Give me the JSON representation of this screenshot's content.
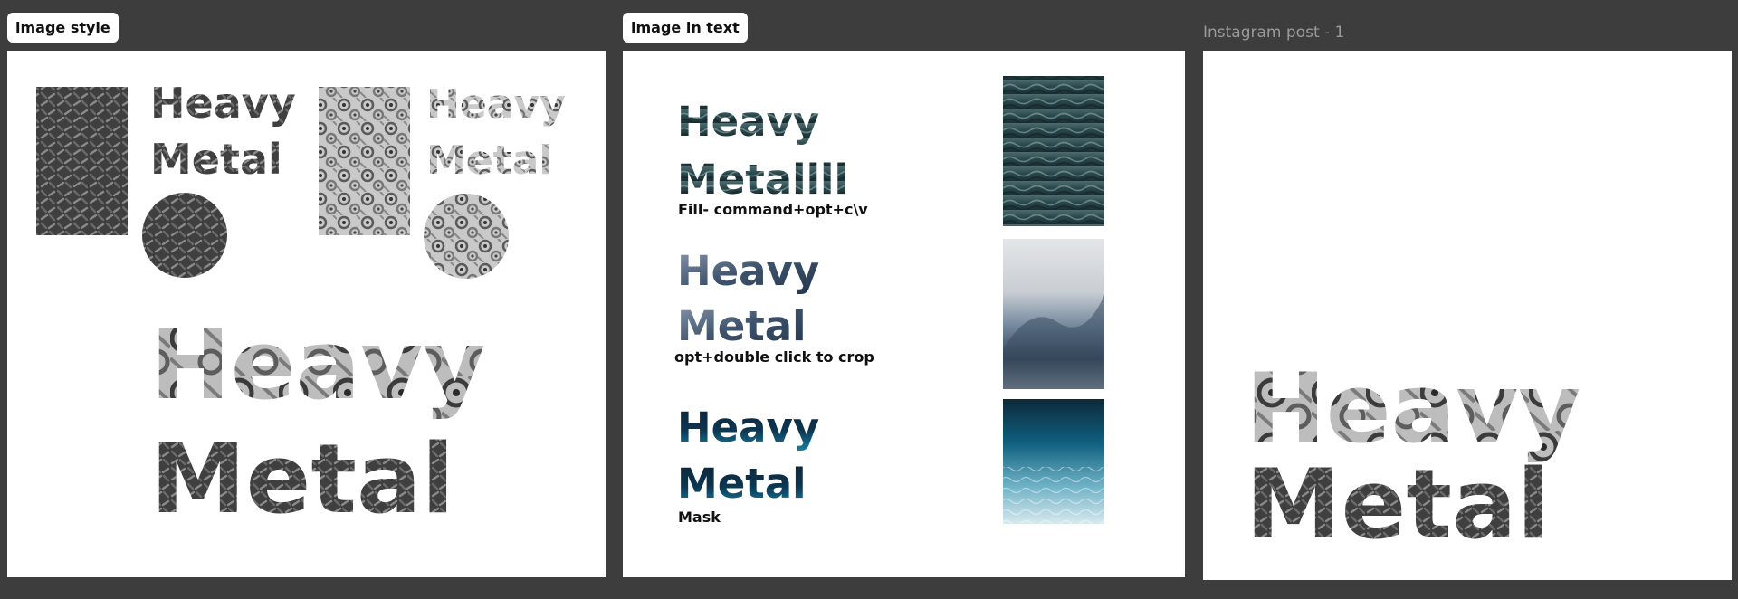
{
  "canvas": {
    "background": "#3d3d3d",
    "frames": [
      {
        "label": "image style",
        "word1": "Heavy",
        "word2": "Metal"
      },
      {
        "label": "image in text",
        "examples": [
          {
            "word1": "Heavy",
            "word2": "Metallll",
            "caption": "Fill- command+opt+c\\v"
          },
          {
            "word1": "Heavy",
            "word2": "Metal",
            "caption": "opt+double click to crop"
          },
          {
            "word1": "Heavy",
            "word2": "Metal",
            "caption": "Mask"
          }
        ]
      },
      {
        "name": "Instagram post - 1",
        "word1": "Heavy",
        "word2": "Metal"
      }
    ]
  },
  "colors": {
    "frame_bg": "#ffffff",
    "plate_dark": "#3f3f3f",
    "gears_light": "#c9c9c9",
    "water_dark": "#29464a",
    "splash_blue": "#6d8399",
    "ocean_teal": "#0f5f7f"
  },
  "icons": {
    "image-fill": "pattern-swatch"
  }
}
